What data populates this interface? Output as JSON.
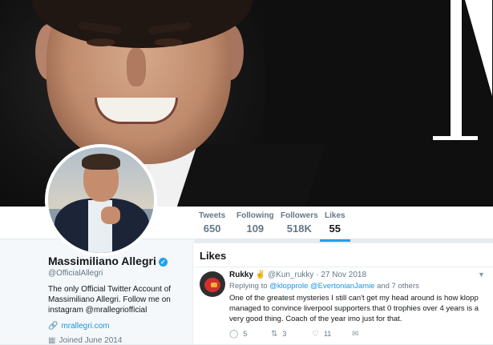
{
  "profile": {
    "name": "Massimiliano Allegri",
    "handle": "@OfficialAllegri",
    "bio": "The only Official Twitter Account of Massimiliano Allegri. Follow me on instagram @mrallegriofficial",
    "link": "mrallegri.com",
    "joined": "Joined June 2014",
    "verified_mark": "✓"
  },
  "nav": {
    "stats": [
      {
        "label": "Tweets",
        "value": "650"
      },
      {
        "label": "Following",
        "value": "109"
      },
      {
        "label": "Followers",
        "value": "518K"
      },
      {
        "label": "Likes",
        "value": "55"
      }
    ],
    "active": "Likes"
  },
  "likes": {
    "title": "Likes",
    "tweet": {
      "display_name": "Rukky",
      "emoji": "✌",
      "handle": "@Kun_rukky",
      "separator": "·",
      "date": "27 Nov 2018",
      "reply_prefix": "Replying to",
      "reply_to_1": "@klopprole",
      "reply_to_2": "@EvertonianJamie",
      "reply_suffix": "and 7 others",
      "text": "One of the greatest mysteries I still can't get my head around is how klopp managed to convince liverpool supporters that 0 trophies over 4 years is a very good thing. Coach of the year imo just for that.",
      "reply_count": "5",
      "retweet_count": "3",
      "like_count": "11"
    }
  },
  "icons": {
    "link": "link-icon",
    "calendar": "calendar-icon",
    "reply": "reply-icon",
    "retweet": "retweet-icon",
    "like": "heart-icon",
    "dm": "envelope-icon",
    "caret": "chevron-down-icon"
  },
  "colors": {
    "accent": "#1da1f2",
    "link": "#1b95e0",
    "text": "#14171a",
    "muted": "#657786"
  }
}
